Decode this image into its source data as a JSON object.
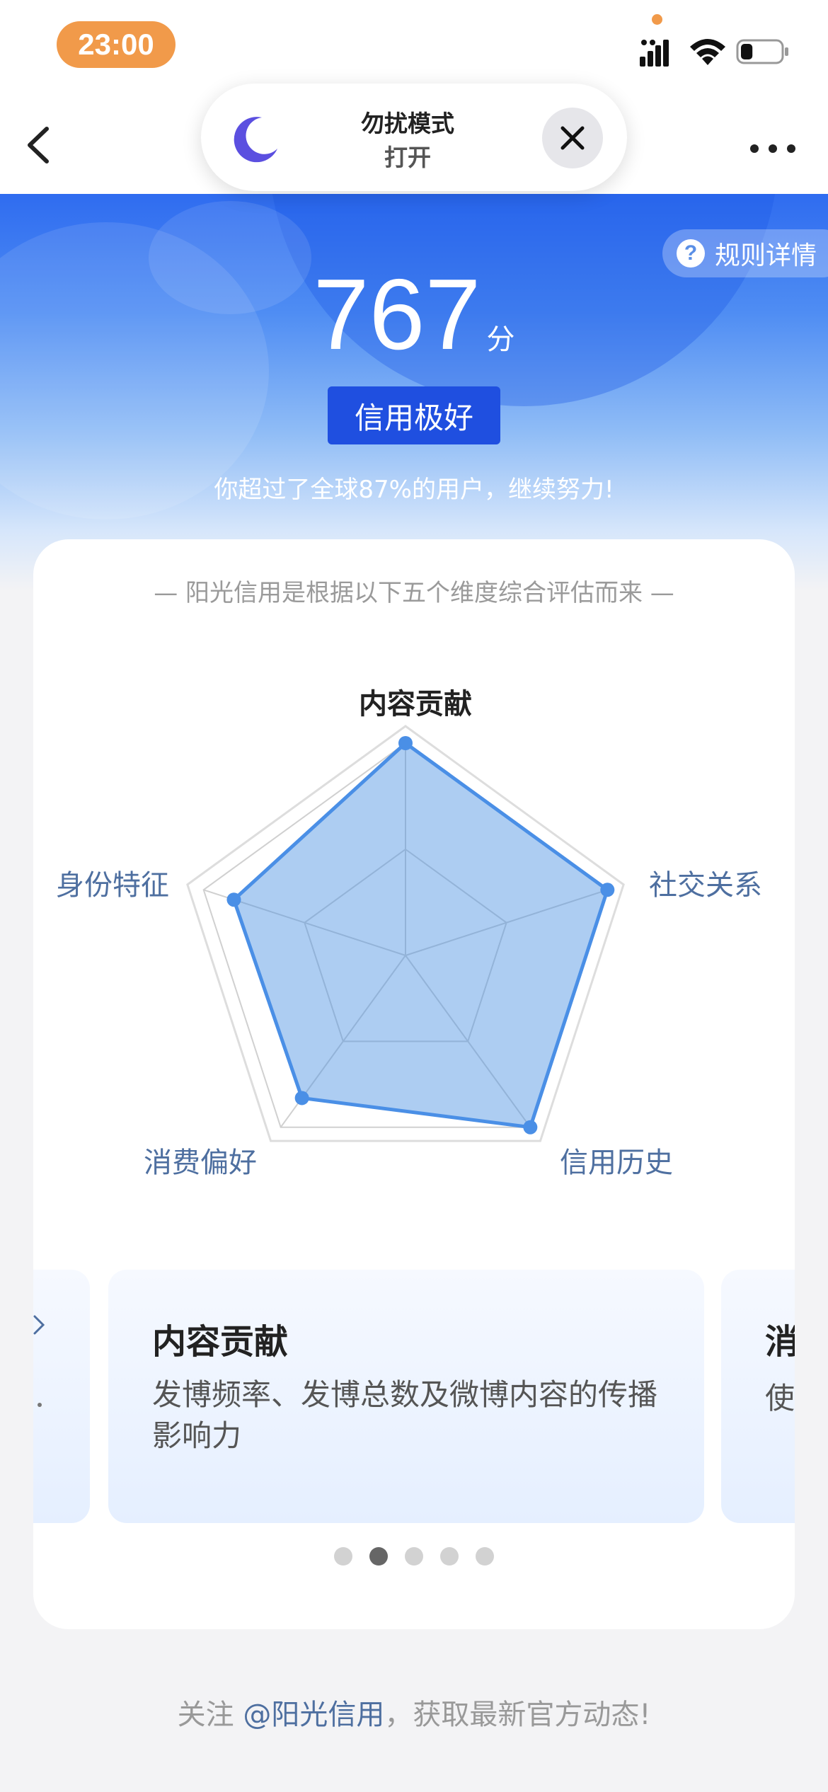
{
  "status_bar": {
    "time": "23:00",
    "icons": [
      "signal-icon",
      "wifi-icon",
      "battery-icon"
    ],
    "battery_level": 0.3
  },
  "nav": {
    "back_icon": "chevron-left-icon",
    "more_icon": "more-horizontal-icon"
  },
  "dnd_banner": {
    "title": "勿扰模式",
    "status": "打开",
    "icon": "moon-icon",
    "close_icon": "close-icon"
  },
  "hero": {
    "rules_label": "规则详情",
    "help_icon_glyph": "?",
    "score": "767",
    "score_unit": "分",
    "level": "信用极好",
    "percentile_text": "你超过了全球87%的用户，继续努力!"
  },
  "card": {
    "subtitle": "— 阳光信用是根据以下五个维度综合评估而来 —"
  },
  "chart_data": {
    "type": "radar",
    "axes": [
      "内容贡献",
      "社交关系",
      "信用历史",
      "消费偏好",
      "身份特征"
    ],
    "values": [
      1.0,
      1.0,
      1.0,
      0.83,
      0.85
    ],
    "rmax": 1.0,
    "rings": 2,
    "outer_reference": true
  },
  "dimension_cards": {
    "left_peek": {
      "chevron": "chevron-right-icon"
    },
    "current": {
      "title": "内容贡献",
      "description": "发博频率、发博总数及微博内容的传播影响力"
    },
    "right_peek": {
      "title": "消",
      "description": "使"
    }
  },
  "pagination": {
    "count": 5,
    "active": 1
  },
  "footer": {
    "prefix": "关注 ",
    "handle": "@阳光信用",
    "suffix": "，获取最新官方动态!"
  },
  "colors": {
    "accent": "#1f4fe0",
    "radar_fill": "#4a90e2",
    "radar_stroke": "#4a8fe6",
    "time_pill": "#f19a4a",
    "axis_label": "#4e6fa0"
  }
}
